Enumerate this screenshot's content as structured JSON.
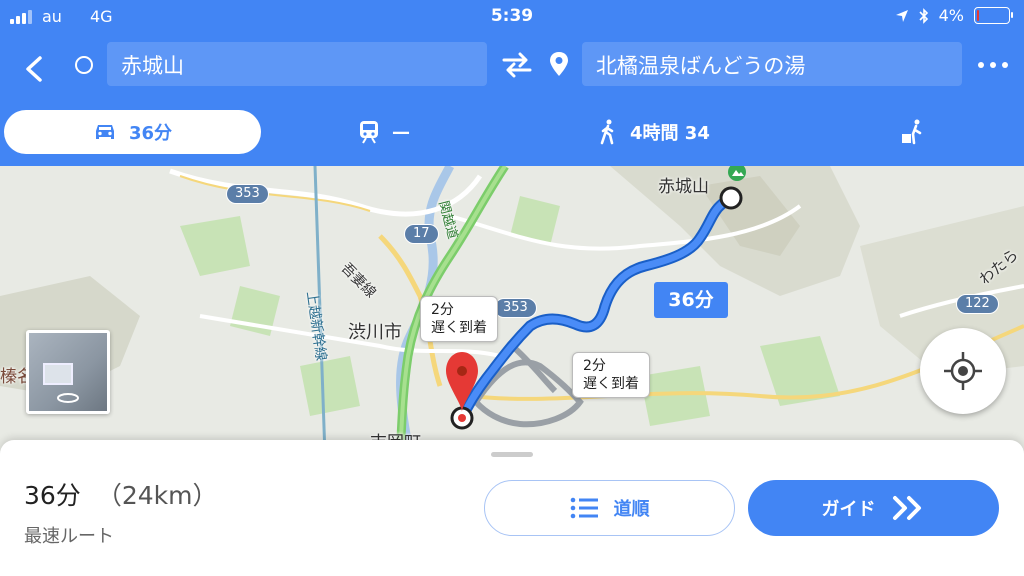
{
  "status_bar": {
    "carrier": "au",
    "network": "4G",
    "time": "5:39",
    "battery": "4%",
    "battery_level": 0.04,
    "battery_color": "#e53935"
  },
  "header": {
    "origin": "赤城山",
    "destination": "北橘温泉ばんどうの湯",
    "accent_color": "#4285f4"
  },
  "modes": {
    "drive": {
      "label": "36分",
      "icon": "car-icon"
    },
    "transit": {
      "label": "—",
      "icon": "train-icon"
    },
    "walk": {
      "label": "4時間 34",
      "icon": "walking-icon"
    },
    "ride": {
      "icon": "ride-share-icon"
    }
  },
  "map": {
    "labels": {
      "akagi": "赤城山",
      "shibukawa": "渋川市",
      "harunasan": "榛名",
      "yoshioka": "吉岡町",
      "watarase": "わたら",
      "kanetsu": "関越道",
      "joetsu": "上越新幹線",
      "agatsuma": "吾妻線"
    },
    "shields": {
      "r353a": "353",
      "r353b": "353",
      "r17": "17",
      "r122": "122"
    },
    "alt_routes": [
      {
        "time": "2分",
        "note": "遅く到着"
      },
      {
        "time": "2分",
        "note": "遅く到着"
      }
    ],
    "route_time": "36分",
    "route_color": "#4285f4",
    "alt_route_color": "#9aa0a6"
  },
  "sheet": {
    "duration": "36分",
    "distance": "（24km）",
    "route_type": "最速ルート",
    "steps_label": "道順",
    "guide_label": "ガイド"
  }
}
